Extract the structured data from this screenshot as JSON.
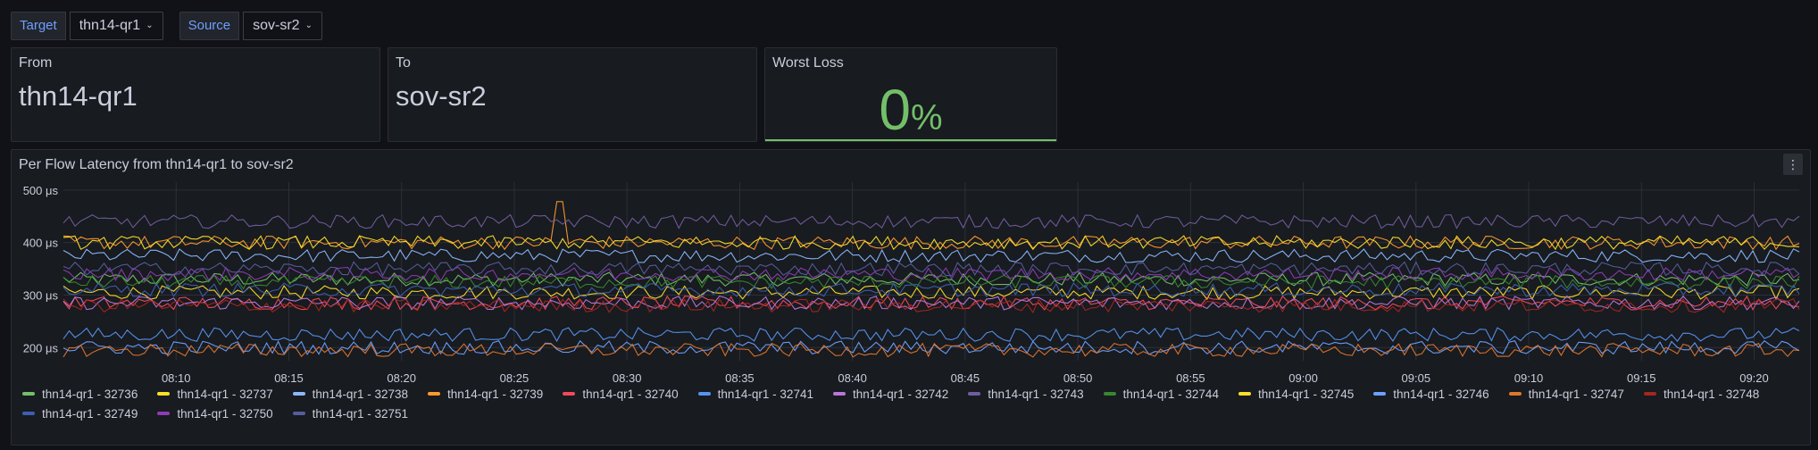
{
  "variables": [
    {
      "label": "Target",
      "value": "thn14-qr1"
    },
    {
      "label": "Source",
      "value": "sov-sr2"
    }
  ],
  "from_panel": {
    "title": "From",
    "value": "thn14-qr1"
  },
  "to_panel": {
    "title": "To",
    "value": "sov-sr2"
  },
  "loss_panel": {
    "title": "Worst Loss",
    "value": "0",
    "unit": "%",
    "color": "#73bf69"
  },
  "chart_panel": {
    "title": "Per Flow Latency from thn14-qr1 to sov-sr2",
    "menu_icon": "kebab-menu-icon"
  },
  "chart_data": {
    "type": "line",
    "y_unit": "μs",
    "y_ticks": [
      "200 μs",
      "300 μs",
      "400 μs",
      "500 μs"
    ],
    "y_tick_values": [
      200,
      300,
      400,
      500
    ],
    "ylim": [
      175,
      515
    ],
    "x_ticks": [
      "08:10",
      "08:15",
      "08:20",
      "08:25",
      "08:30",
      "08:35",
      "08:40",
      "08:45",
      "08:50",
      "08:55",
      "09:00",
      "09:05",
      "09:10",
      "09:15",
      "09:20"
    ],
    "x_range": [
      "08:05",
      "09:22"
    ],
    "grid": true,
    "legend_position": "bottom",
    "series": [
      {
        "name": "thn14-qr1 - 32736",
        "color": "#73bf69",
        "mean": 330
      },
      {
        "name": "thn14-qr1 - 32737",
        "color": "#fade2a",
        "mean": 305
      },
      {
        "name": "thn14-qr1 - 32738",
        "color": "#8ab8ff",
        "mean": 375
      },
      {
        "name": "thn14-qr1 - 32739",
        "color": "#ff9830",
        "mean": 400
      },
      {
        "name": "thn14-qr1 - 32740",
        "color": "#f2495c",
        "mean": 285
      },
      {
        "name": "thn14-qr1 - 32741",
        "color": "#5794f2",
        "mean": 225
      },
      {
        "name": "thn14-qr1 - 32742",
        "color": "#b877d9",
        "mean": 285
      },
      {
        "name": "thn14-qr1 - 32743",
        "color": "#705da0",
        "mean": 440
      },
      {
        "name": "thn14-qr1 - 32744",
        "color": "#37872d",
        "mean": 325
      },
      {
        "name": "thn14-qr1 - 32745",
        "color": "#fade2a",
        "mean": 400
      },
      {
        "name": "thn14-qr1 - 32746",
        "color": "#6e9fff",
        "mean": 200
      },
      {
        "name": "thn14-qr1 - 32747",
        "color": "#e0752d",
        "mean": 195
      },
      {
        "name": "thn14-qr1 - 32748",
        "color": "#a3261f",
        "mean": 280
      },
      {
        "name": "thn14-qr1 - 32749",
        "color": "#3d5fb0",
        "mean": 310
      },
      {
        "name": "thn14-qr1 - 32750",
        "color": "#8f3bb8",
        "mean": 340
      },
      {
        "name": "thn14-qr1 - 32751",
        "color": "#565d9e",
        "mean": 350
      }
    ],
    "annotations": [
      {
        "series": "thn14-qr1 - 32739",
        "x": "08:27",
        "y": 478,
        "note": "spike"
      }
    ]
  }
}
